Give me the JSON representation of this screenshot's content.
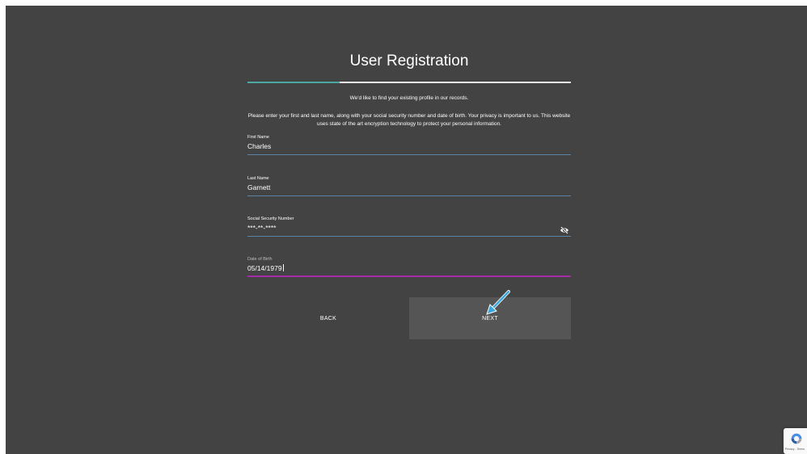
{
  "header": {
    "title": "User Registration"
  },
  "progress": {
    "fraction": 0.285
  },
  "text": {
    "intro": "We'd like to find your existing profile in our records.",
    "privacy": "Please enter your first and last name, along with your social security number and date of birth. Your privacy is important to us. This website uses state of the art encryption technology to protect your personal information."
  },
  "fields": {
    "first_name": {
      "label": "First Name",
      "value": "Charles"
    },
    "last_name": {
      "label": "Last Name",
      "value": "Garnett"
    },
    "ssn": {
      "label": "Social Security Number",
      "value": "***-**-****"
    },
    "dob": {
      "label": "Date of Birth",
      "value": "05/14/1979"
    }
  },
  "buttons": {
    "back": "BACK",
    "next": "NEXT"
  },
  "recaptcha": {
    "text": "Privacy - Terms"
  },
  "colors": {
    "background": "#434343",
    "progress_accent": "#4aa7a1",
    "field_underline": "#5b84a6",
    "active_underline": "#a42aa8",
    "next_button": "#555555",
    "annotation_arrow": "#3ba6d9"
  },
  "icons": {
    "password_toggle": "eye-slash-icon",
    "annotation": "arrow-pointer-icon"
  }
}
